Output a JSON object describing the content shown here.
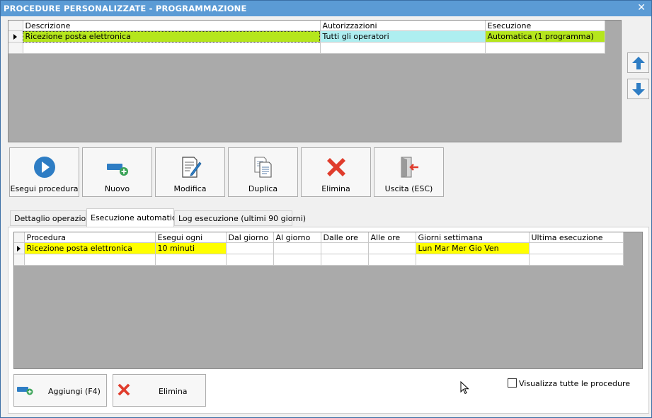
{
  "window": {
    "title": "PROCEDURE PERSONALIZZATE -  PROGRAMMAZIONE",
    "close_glyph": "✕"
  },
  "procedures_grid": {
    "columns": [
      "Descrizione",
      "Autorizzazioni",
      "Esecuzione"
    ],
    "rows": [
      [
        "Ricezione posta elettronica",
        "Tutti gli operatori",
        "Automatica (1 programma)"
      ]
    ]
  },
  "toolbar": {
    "run": "Esegui procedura",
    "new": "Nuovo",
    "edit": "Modifica",
    "duplicate": "Duplica",
    "delete": "Elimina",
    "exit": "Uscita (ESC)"
  },
  "tabs": [
    "Dettaglio operazioni",
    "Esecuzione automatica",
    "Log esecuzione (ultimi 90 giorni)"
  ],
  "schedule_grid": {
    "columns": [
      "Procedura",
      "Esegui ogni",
      "Dal giorno",
      "Al giorno",
      "Dalle ore",
      "Alle ore",
      "Giorni settimana",
      "Ultima esecuzione"
    ],
    "rows": [
      [
        "Ricezione posta elettronica",
        "10 minuti",
        "",
        "",
        "",
        "",
        "Lun Mar Mer Gio Ven",
        ""
      ]
    ]
  },
  "bottom": {
    "add": "Aggiungi (F4)",
    "delete": "Elimina",
    "show_all": "Visualizza tutte le procedure"
  },
  "colors": {
    "titlebar": "#5b9bd5",
    "row_green": "#b5e61d",
    "row_cyan": "#aeeef0",
    "row_yellow": "#ffff00",
    "arrow_blue": "#2e7dc4",
    "delete_red": "#e03c2c"
  }
}
